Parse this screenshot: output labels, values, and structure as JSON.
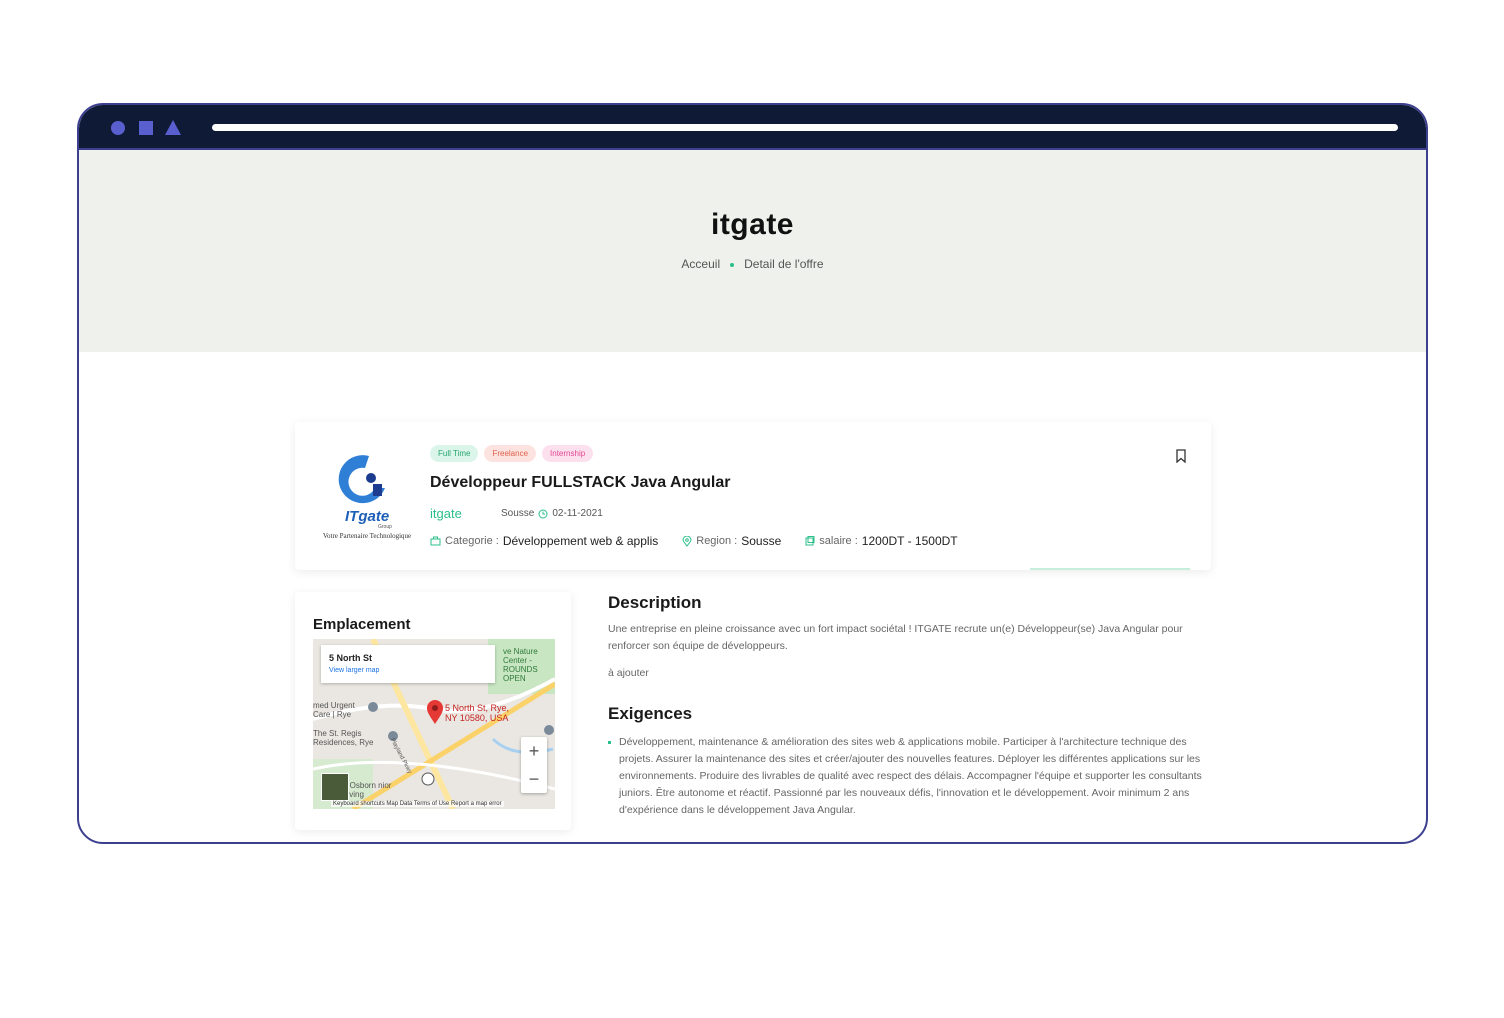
{
  "hero": {
    "title": "itgate",
    "breadcrumb": [
      "Acceuil",
      "Detail de l'offre"
    ]
  },
  "job": {
    "logo_text": "ITgate",
    "logo_subtext": "Group",
    "logo_tagline": "Votre Partenaire Technologique",
    "tags": [
      "Full Time",
      "Freelance",
      "Internship"
    ],
    "title": "Développeur FULLSTACK Java Angular",
    "company": "itgate",
    "location": "Sousse",
    "date": "02-11-2021",
    "categorie_label": "Categorie :",
    "categorie_value": "Développement web & applis",
    "region_label": "Region :",
    "region_value": "Sousse",
    "salaire_label": "salaire :",
    "salaire_value": "1200DT - 1500DT"
  },
  "emplacement": {
    "title": "Emplacement",
    "map": {
      "popup_address": "5 North St",
      "popup_link": "View larger map",
      "pin_label": "5 North St, Rye, NY 10580, USA",
      "labels": [
        "ve Nature Center - ROUNDS OPEN",
        "med Urgent Care | Rye",
        "The St. Regis Residences, Rye",
        "e Osborn nior Living"
      ],
      "road_label": "Playland Pkwy",
      "footer": "Keyboard shortcuts   Map Data   Terms of Use   Report a map error",
      "zoom_in": "+",
      "zoom_out": "−"
    }
  },
  "description": {
    "title": "Description",
    "text": "Une entreprise en pleine croissance avec un fort impact sociétal ! ITGATE recrute un(e) Développeur(se) Java Angular pour renforcer son équipe de développeurs.",
    "extra": "à ajouter"
  },
  "exigences": {
    "title": "Exigences",
    "items": [
      "Développement, maintenance & amélioration des sites web & applications mobile. Participer à l'architecture technique des projets. Assurer la maintenance des sites et créer/ajouter des nouvelles features. Déployer les différentes applications sur les environnements. Produire des livrables de qualité avec respect des délais. Accompagner l'équipe et supporter les consultants juniors. Être autonome et réactif. Passionné par les nouveaux défis, l'innovation et le développement. Avoir minimum 2 ans d'expérience dans le développement Java Angular."
    ]
  },
  "colors": {
    "topbar": "#0e1a36",
    "frame": "#3d3f8f",
    "accent": "#2bbf8a",
    "hero_bg": "#eff2ec"
  }
}
